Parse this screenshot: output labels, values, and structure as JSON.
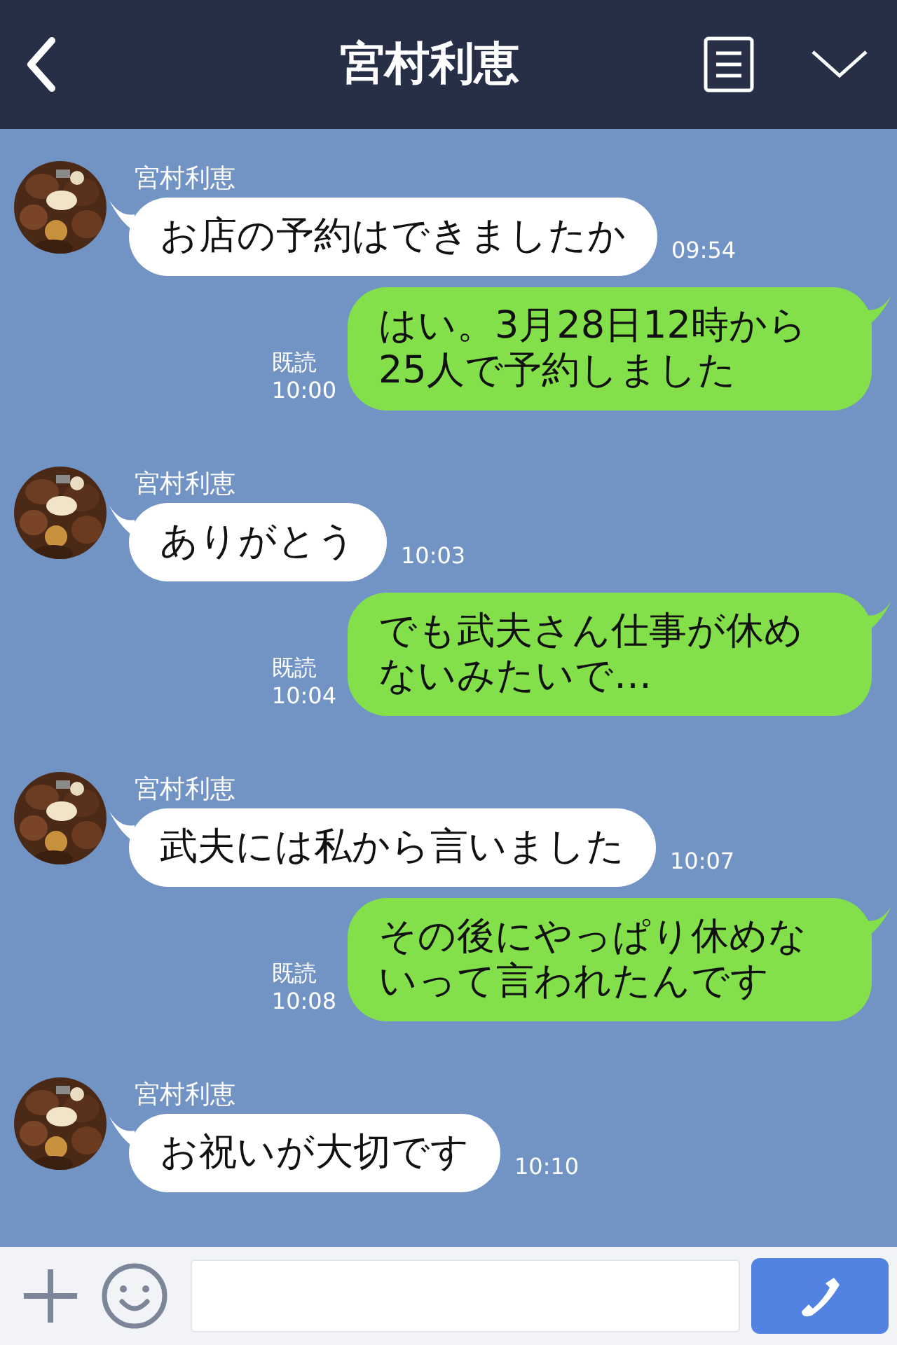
{
  "header": {
    "title": "宮村利恵"
  },
  "messages": [
    {
      "kind": "received",
      "sender": "宮村利恵",
      "text": "お店の予約はできましたか",
      "time": "09:54"
    },
    {
      "kind": "sent",
      "text": "はい。3月28日12時から25人で予約しました",
      "read": "既読",
      "time": "10:00"
    },
    {
      "kind": "received",
      "sender": "宮村利恵",
      "text": "ありがとう",
      "time": "10:03"
    },
    {
      "kind": "sent",
      "text": "でも武夫さん仕事が休めないみたいで…",
      "read": "既読",
      "time": "10:04"
    },
    {
      "kind": "received",
      "sender": "宮村利恵",
      "text": "武夫には私から言いました",
      "time": "10:07"
    },
    {
      "kind": "sent",
      "text": "その後にやっぱり休めないって言われたんです",
      "read": "既読",
      "time": "10:08"
    },
    {
      "kind": "received",
      "sender": "宮村利恵",
      "text": "お祝いが大切です",
      "time": "10:10"
    }
  ]
}
